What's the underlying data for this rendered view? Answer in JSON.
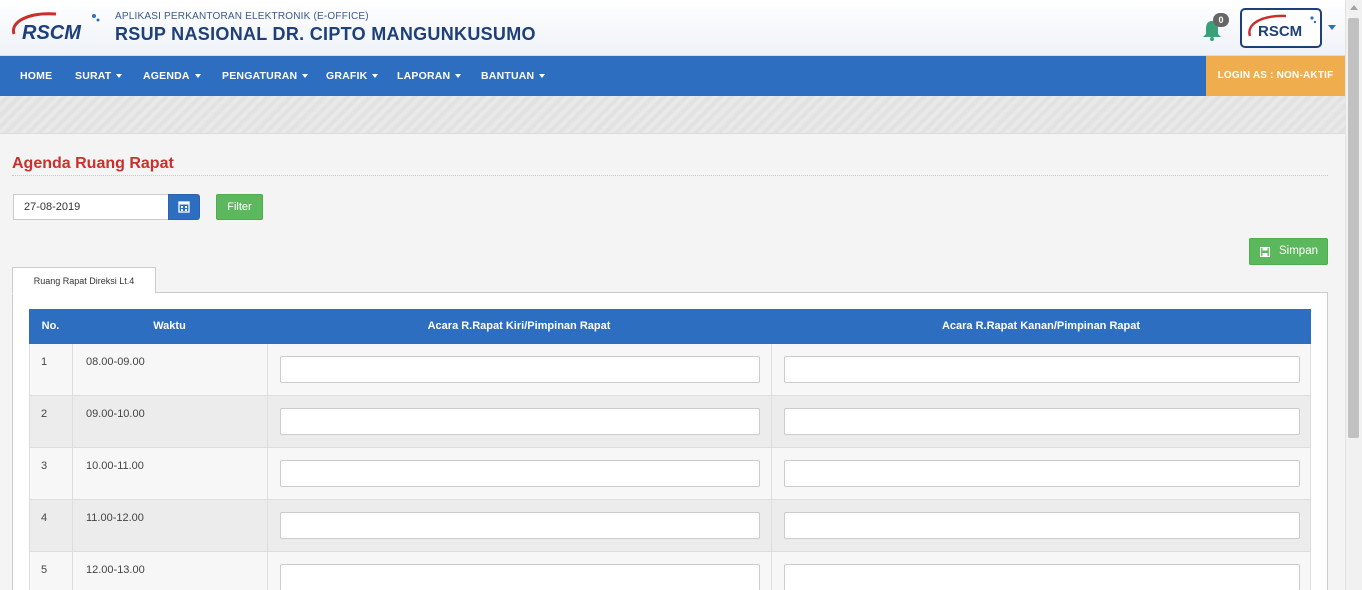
{
  "header": {
    "logo_text": "RSCM",
    "subtitle": "APLIKASI PERKANTORAN ELEKTRONIK (E-OFFICE)",
    "title": "RSUP NASIONAL DR. CIPTO MANGUNKUSUMO",
    "notification_count": "0",
    "avatar_text": "RSCM"
  },
  "nav": {
    "items": [
      {
        "label": "HOME",
        "has_caret": false
      },
      {
        "label": "SURAT",
        "has_caret": true
      },
      {
        "label": "AGENDA",
        "has_caret": true
      },
      {
        "label": "PENGATURAN",
        "has_caret": true
      },
      {
        "label": "GRAFIK",
        "has_caret": true
      },
      {
        "label": "LAPORAN",
        "has_caret": true
      },
      {
        "label": "BANTUAN",
        "has_caret": true
      }
    ],
    "login_status": "LOGIN AS : NON-AKTIF"
  },
  "page": {
    "title": "Agenda Ruang Rapat",
    "date_value": "27-08-2019",
    "filter_label": "Filter",
    "save_label": "Simpan",
    "tab_label": "Ruang Rapat Direksi Lt.4"
  },
  "table": {
    "headers": [
      "No.",
      "Waktu",
      "Acara R.Rapat Kiri/Pimpinan Rapat",
      "Acara R.Rapat Kanan/Pimpinan Rapat"
    ],
    "rows": [
      {
        "no": "1",
        "time": "08.00-09.00",
        "kiri": "",
        "kanan": ""
      },
      {
        "no": "2",
        "time": "09.00-10.00",
        "kiri": "",
        "kanan": ""
      },
      {
        "no": "3",
        "time": "10.00-11.00",
        "kiri": "",
        "kanan": ""
      },
      {
        "no": "4",
        "time": "11.00-12.00",
        "kiri": "",
        "kanan": ""
      },
      {
        "no": "5",
        "time": "12.00-13.00",
        "kiri": "",
        "kanan": ""
      }
    ]
  },
  "colors": {
    "primary": "#2d6ec0",
    "title_red": "#c9302c",
    "success": "#5cb85c",
    "warning": "#f0ad4e"
  },
  "icons": {
    "logo": "rscm-logo",
    "notification": "bell-icon",
    "calendar": "calendar-icon",
    "save": "floppy-disk-icon"
  }
}
